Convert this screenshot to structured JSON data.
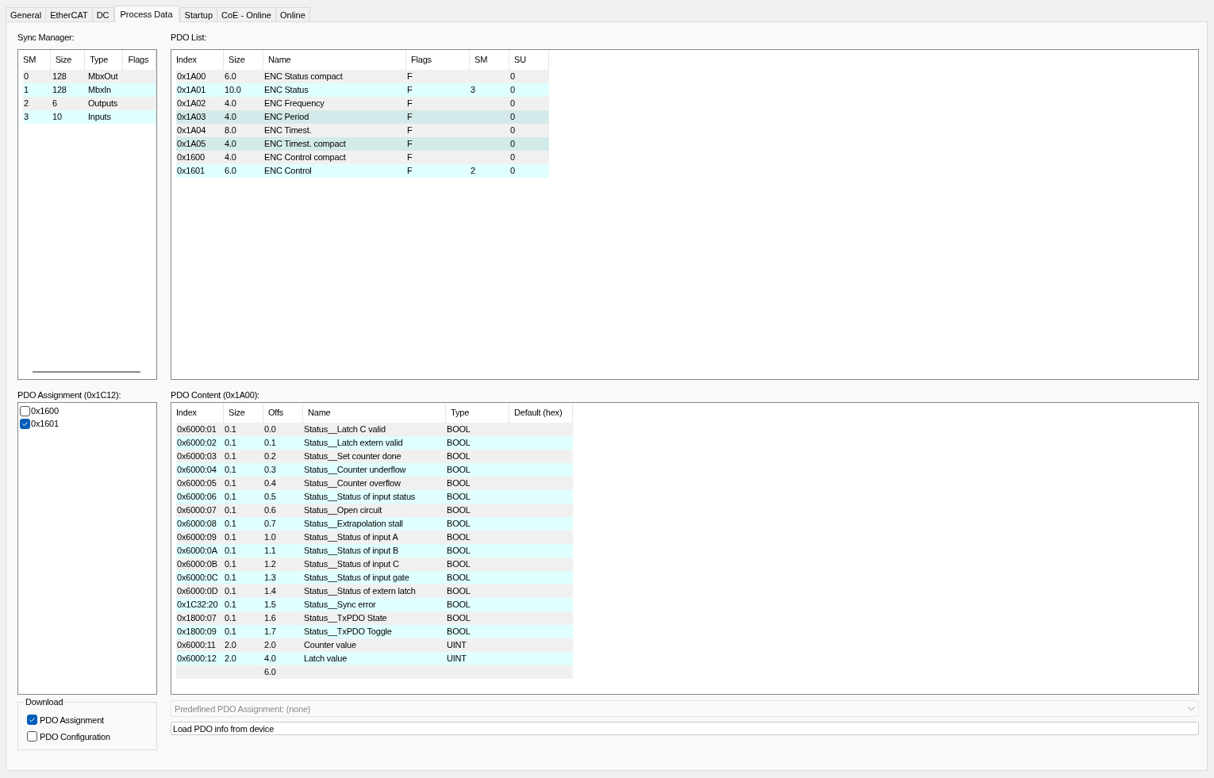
{
  "tabs": [
    {
      "label": "General",
      "selected": false
    },
    {
      "label": "EtherCAT",
      "selected": false
    },
    {
      "label": "DC",
      "selected": false
    },
    {
      "label": "Process Data",
      "selected": true
    },
    {
      "label": "Startup",
      "selected": false
    },
    {
      "label": "CoE - Online",
      "selected": false
    },
    {
      "label": "Online",
      "selected": false
    }
  ],
  "sync_manager": {
    "label": "Sync Manager:",
    "columns": [
      "SM",
      "Size",
      "Type",
      "Flags"
    ],
    "rows": [
      {
        "sm": "0",
        "size": "128",
        "type": "MbxOut"
      },
      {
        "sm": "1",
        "size": "128",
        "type": "MbxIn"
      },
      {
        "sm": "2",
        "size": "6",
        "type": "Outputs"
      },
      {
        "sm": "3",
        "size": "10",
        "type": "Inputs"
      }
    ]
  },
  "pdo_list": {
    "label": "PDO List:",
    "columns": [
      "Index",
      "Size",
      "Name",
      "Flags",
      "SM",
      "SU"
    ],
    "rows": [
      {
        "index": "0x1A00",
        "size": "6.0",
        "name": "ENC Status compact",
        "flags": "F",
        "su": "0",
        "marked": false
      },
      {
        "index": "0x1A01",
        "size": "10.0",
        "name": "ENC Status",
        "flags": "F",
        "sm": "3",
        "su": "0",
        "marked": false
      },
      {
        "index": "0x1A02",
        "size": "4.0",
        "name": "ENC Frequency",
        "flags": "F",
        "su": "0",
        "marked": false
      },
      {
        "index": "0x1A03",
        "size": "4.0",
        "name": "ENC Period",
        "flags": "F",
        "su": "0",
        "marked": true
      },
      {
        "index": "0x1A04",
        "size": "8.0",
        "name": "ENC Timest.",
        "flags": "F",
        "su": "0",
        "marked": false
      },
      {
        "index": "0x1A05",
        "size": "4.0",
        "name": "ENC Timest. compact",
        "flags": "F",
        "su": "0",
        "marked": true
      },
      {
        "index": "0x1600",
        "size": "4.0",
        "name": "ENC Control compact",
        "flags": "F",
        "su": "0",
        "marked": false
      },
      {
        "index": "0x1601",
        "size": "6.0",
        "name": "ENC Control",
        "flags": "F",
        "sm": "2",
        "su": "0",
        "marked": false
      }
    ]
  },
  "pdo_assignment": {
    "label": "PDO Assignment (0x1C12):",
    "items": [
      {
        "label": "0x1600",
        "checked": false
      },
      {
        "label": "0x1601",
        "checked": true
      }
    ]
  },
  "pdo_content": {
    "label": "PDO Content (0x1A00):",
    "columns": [
      "Index",
      "Size",
      "Offs",
      "Name",
      "Type",
      "Default (hex)"
    ],
    "rows": [
      {
        "index": "0x6000:01",
        "size": "0.1",
        "offs": "0.0",
        "name": "Status__Latch C valid",
        "type": "BOOL"
      },
      {
        "index": "0x6000:02",
        "size": "0.1",
        "offs": "0.1",
        "name": "Status__Latch extern valid",
        "type": "BOOL"
      },
      {
        "index": "0x6000:03",
        "size": "0.1",
        "offs": "0.2",
        "name": "Status__Set counter done",
        "type": "BOOL"
      },
      {
        "index": "0x6000:04",
        "size": "0.1",
        "offs": "0.3",
        "name": "Status__Counter underflow",
        "type": "BOOL"
      },
      {
        "index": "0x6000:05",
        "size": "0.1",
        "offs": "0.4",
        "name": "Status__Counter overflow",
        "type": "BOOL"
      },
      {
        "index": "0x6000:06",
        "size": "0.1",
        "offs": "0.5",
        "name": "Status__Status of input status",
        "type": "BOOL"
      },
      {
        "index": "0x6000:07",
        "size": "0.1",
        "offs": "0.6",
        "name": "Status__Open circuit",
        "type": "BOOL"
      },
      {
        "index": "0x6000:08",
        "size": "0.1",
        "offs": "0.7",
        "name": "Status__Extrapolation stall",
        "type": "BOOL"
      },
      {
        "index": "0x6000:09",
        "size": "0.1",
        "offs": "1.0",
        "name": "Status__Status of input A",
        "type": "BOOL"
      },
      {
        "index": "0x6000:0A",
        "size": "0.1",
        "offs": "1.1",
        "name": "Status__Status of input B",
        "type": "BOOL"
      },
      {
        "index": "0x6000:0B",
        "size": "0.1",
        "offs": "1.2",
        "name": "Status__Status of input C",
        "type": "BOOL"
      },
      {
        "index": "0x6000:0C",
        "size": "0.1",
        "offs": "1.3",
        "name": "Status__Status of input gate",
        "type": "BOOL"
      },
      {
        "index": "0x6000:0D",
        "size": "0.1",
        "offs": "1.4",
        "name": "Status__Status of extern latch",
        "type": "BOOL"
      },
      {
        "index": "0x1C32:20",
        "size": "0.1",
        "offs": "1.5",
        "name": "Status__Sync error",
        "type": "BOOL"
      },
      {
        "index": "0x1800:07",
        "size": "0.1",
        "offs": "1.6",
        "name": "Status__TxPDO State",
        "type": "BOOL"
      },
      {
        "index": "0x1800:09",
        "size": "0.1",
        "offs": "1.7",
        "name": "Status__TxPDO Toggle",
        "type": "BOOL"
      },
      {
        "index": "0x6000:11",
        "size": "2.0",
        "offs": "2.0",
        "name": "Counter value",
        "type": "UINT"
      },
      {
        "index": "0x6000:12",
        "size": "2.0",
        "offs": "4.0",
        "name": "Latch value",
        "type": "UINT"
      },
      {
        "offs": "6.0"
      }
    ]
  },
  "download": {
    "label": "Download",
    "options": [
      {
        "label": "PDO Assignment",
        "checked": true
      },
      {
        "label": "PDO Configuration",
        "checked": false
      }
    ]
  },
  "predefined_dropdown": {
    "value": "Predefined PDO Assignment: (none)",
    "disabled": true
  },
  "load_button": {
    "label": "Load PDO info from device"
  }
}
